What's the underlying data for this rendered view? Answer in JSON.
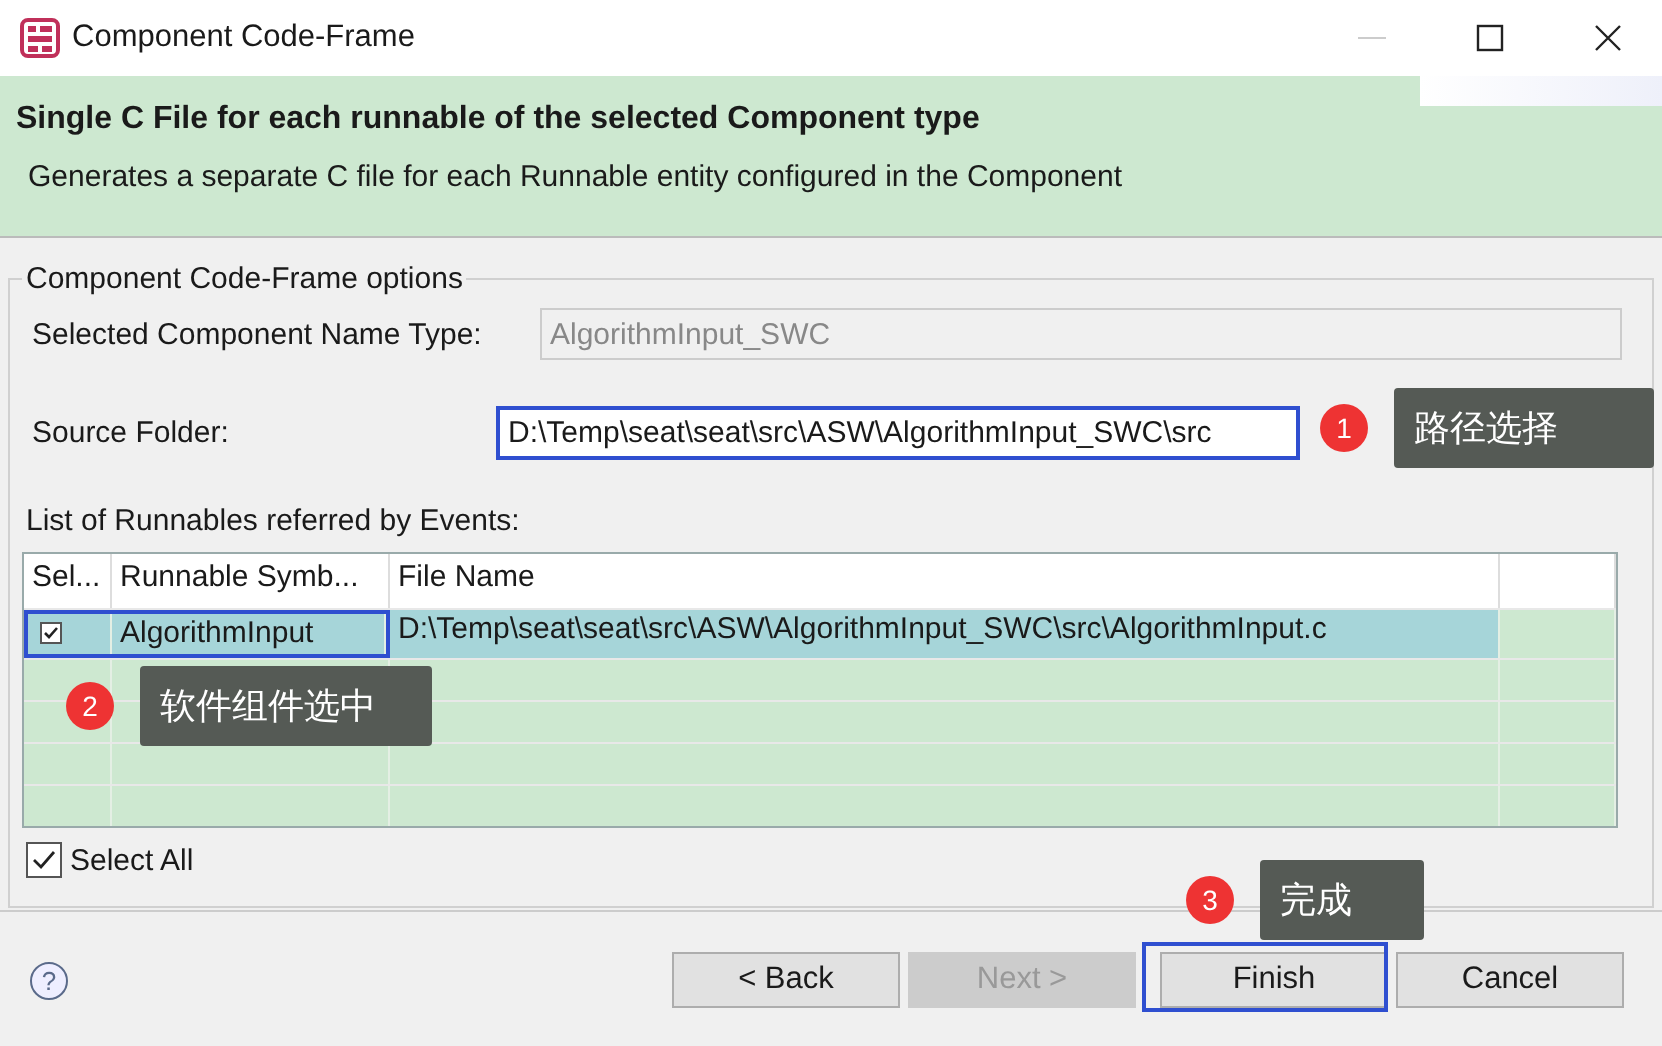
{
  "window": {
    "title": "Component Code-Frame"
  },
  "header": {
    "title": "Single C File for each runnable of the selected Component type",
    "description": "Generates a separate C file for each Runnable entity configured in the Component"
  },
  "options": {
    "legend": "Component Code-Frame options",
    "component_name_type": {
      "label": "Selected Component Name Type:",
      "value": "AlgorithmInput_SWC",
      "disabled": true
    },
    "source_folder": {
      "label": "Source Folder:",
      "value": "D:\\Temp\\seat\\seat\\src\\ASW\\AlgorithmInput_SWC\\src"
    }
  },
  "runnables": {
    "label": "List of Runnables referred by Events:",
    "columns": [
      "Sel...",
      "Runnable Symb...",
      "File Name"
    ],
    "rows": [
      {
        "checked": true,
        "selected": true,
        "symbol": "AlgorithmInput",
        "file": "D:\\Temp\\seat\\seat\\src\\ASW\\AlgorithmInput_SWC\\src\\AlgorithmInput.c"
      }
    ],
    "select_all": {
      "label": "Select All",
      "checked": true
    }
  },
  "help": {
    "label": "?"
  },
  "buttons": [
    {
      "label": "< Back",
      "disabled": false
    },
    {
      "label": "Next >",
      "disabled": true
    },
    {
      "label": "Finish",
      "disabled": false
    },
    {
      "label": "Cancel",
      "disabled": false
    }
  ],
  "annotations": [
    {
      "number": "1",
      "text": "路径选择"
    },
    {
      "number": "2",
      "text": "软件组件选中"
    },
    {
      "number": "3",
      "text": "完成"
    }
  ]
}
